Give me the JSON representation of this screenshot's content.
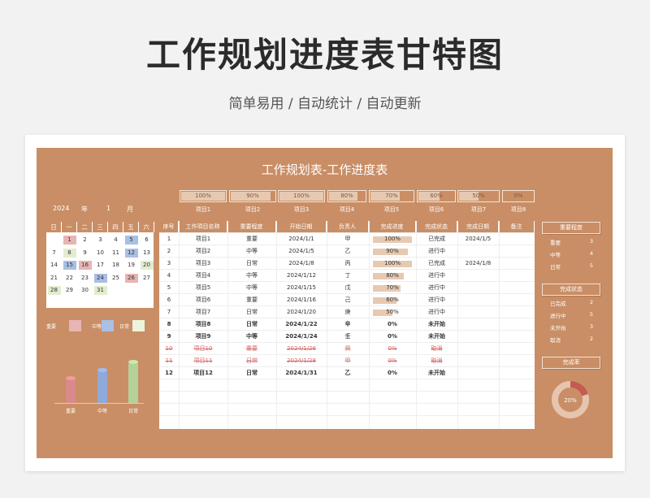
{
  "title": "工作规划进度表甘特图",
  "subtitle": "简单易用 / 自动统计 / 自动更新",
  "sheet": {
    "title": "工作规划表-工作进度表",
    "year": "2024",
    "year_label": "年",
    "month": "1",
    "month_label": "月",
    "project_progress": [
      {
        "label": "项目1",
        "value": "100%",
        "fraction": 1.0
      },
      {
        "label": "项目2",
        "value": "90%",
        "fraction": 0.9
      },
      {
        "label": "项目3",
        "value": "100%",
        "fraction": 1.0
      },
      {
        "label": "项目4",
        "value": "80%",
        "fraction": 0.8
      },
      {
        "label": "项目5",
        "value": "70%",
        "fraction": 0.7
      },
      {
        "label": "项目6",
        "value": "60%",
        "fraction": 0.6
      },
      {
        "label": "项目7",
        "value": "50%",
        "fraction": 0.5
      },
      {
        "label": "项目8",
        "value": "0%",
        "fraction": 0.0
      }
    ],
    "calendar": {
      "weekdays": [
        "日",
        "一",
        "二",
        "三",
        "四",
        "五",
        "六"
      ],
      "weeks": [
        [
          "",
          "1",
          "2",
          "3",
          "4",
          "5",
          "6"
        ],
        [
          "7",
          "8",
          "9",
          "10",
          "11",
          "12",
          "13"
        ],
        [
          "14",
          "15",
          "16",
          "17",
          "18",
          "19",
          "20"
        ],
        [
          "21",
          "22",
          "23",
          "24",
          "25",
          "26",
          "27"
        ],
        [
          "28",
          "29",
          "30",
          "31",
          "",
          "",
          ""
        ]
      ],
      "colors": {
        "important": "#e8b4b4",
        "medium": "#a9bfe3",
        "normal": "#e2edd0"
      },
      "marks": {
        "1": "important",
        "5": "medium",
        "8": "normal",
        "12": "medium",
        "15": "medium",
        "16": "important",
        "20": "normal",
        "24": "medium",
        "26": "important",
        "28": "normal",
        "31": "normal"
      }
    },
    "legend": [
      {
        "label": "重要",
        "color": "#e8b4b4"
      },
      {
        "label": "中等",
        "color": "#a9bfe3"
      },
      {
        "label": "日常",
        "color": "#eef3dc"
      }
    ],
    "bars": [
      {
        "label": "重要",
        "value": 3,
        "color": "#d98a8a"
      },
      {
        "label": "中等",
        "value": 4,
        "color": "#8fa9d8"
      },
      {
        "label": "日常",
        "value": 5,
        "color": "#b4d19a"
      }
    ],
    "table": {
      "headers": [
        "序号",
        "工作项目名称",
        "重要程度",
        "开始日期",
        "负责人",
        "完成进度",
        "完成状态",
        "完成日期",
        "备注"
      ],
      "rows": [
        {
          "no": "1",
          "name": "项目1",
          "level": "重要",
          "start": "2024/1/1",
          "owner": "甲",
          "progress": "100%",
          "fraction": 1.0,
          "status": "已完成",
          "done": "2024/1/5",
          "note": "",
          "style": "normal"
        },
        {
          "no": "2",
          "name": "项目2",
          "level": "中等",
          "start": "2024/1/5",
          "owner": "乙",
          "progress": "90%",
          "fraction": 0.9,
          "status": "进行中",
          "done": "",
          "note": "",
          "style": "normal"
        },
        {
          "no": "3",
          "name": "项目3",
          "level": "日常",
          "start": "2024/1/8",
          "owner": "丙",
          "progress": "100%",
          "fraction": 1.0,
          "status": "已完成",
          "done": "2024/1/8",
          "note": "",
          "style": "normal"
        },
        {
          "no": "4",
          "name": "项目4",
          "level": "中等",
          "start": "2024/1/12",
          "owner": "丁",
          "progress": "80%",
          "fraction": 0.8,
          "status": "进行中",
          "done": "",
          "note": "",
          "style": "normal"
        },
        {
          "no": "5",
          "name": "项目5",
          "level": "中等",
          "start": "2024/1/15",
          "owner": "戊",
          "progress": "70%",
          "fraction": 0.7,
          "status": "进行中",
          "done": "",
          "note": "",
          "style": "normal"
        },
        {
          "no": "6",
          "name": "项目6",
          "level": "重要",
          "start": "2024/1/16",
          "owner": "己",
          "progress": "60%",
          "fraction": 0.6,
          "status": "进行中",
          "done": "",
          "note": "",
          "style": "normal"
        },
        {
          "no": "7",
          "name": "项目7",
          "level": "日常",
          "start": "2024/1/20",
          "owner": "庚",
          "progress": "50%",
          "fraction": 0.5,
          "status": "进行中",
          "done": "",
          "note": "",
          "style": "normal"
        },
        {
          "no": "8",
          "name": "项目8",
          "level": "日常",
          "start": "2024/1/22",
          "owner": "辛",
          "progress": "0%",
          "fraction": 0.0,
          "status": "未开始",
          "done": "",
          "note": "",
          "style": "bold"
        },
        {
          "no": "9",
          "name": "项目9",
          "level": "中等",
          "start": "2024/1/24",
          "owner": "壬",
          "progress": "0%",
          "fraction": 0.0,
          "status": "未开始",
          "done": "",
          "note": "",
          "style": "bold"
        },
        {
          "no": "10",
          "name": "项目10",
          "level": "重要",
          "start": "2024/1/26",
          "owner": "癸",
          "progress": "0%",
          "fraction": 0.0,
          "status": "取消",
          "done": "",
          "note": "",
          "style": "cancel"
        },
        {
          "no": "11",
          "name": "项目11",
          "level": "日常",
          "start": "2024/1/28",
          "owner": "甲",
          "progress": "0%",
          "fraction": 0.0,
          "status": "取消",
          "done": "",
          "note": "",
          "style": "cancel"
        },
        {
          "no": "12",
          "name": "项目12",
          "level": "日常",
          "start": "2024/1/31",
          "owner": "乙",
          "progress": "0%",
          "fraction": 0.0,
          "status": "未开始",
          "done": "",
          "note": "",
          "style": "bold"
        }
      ]
    },
    "summary": {
      "importance_title": "重要程度",
      "importance": [
        {
          "label": "重要",
          "value": "3"
        },
        {
          "label": "中等",
          "value": "4"
        },
        {
          "label": "日常",
          "value": "5"
        }
      ],
      "status_title": "完成状态",
      "status": [
        {
          "label": "已完成",
          "value": "2"
        },
        {
          "label": "进行中",
          "value": "5"
        },
        {
          "label": "未开始",
          "value": "3"
        },
        {
          "label": "取消",
          "value": "2"
        }
      ],
      "rate_title": "完成率",
      "rate": "20%",
      "rate_fraction": 0.2,
      "rate_color": "#c55b4e",
      "rate_track": "#e6c4ae"
    }
  }
}
